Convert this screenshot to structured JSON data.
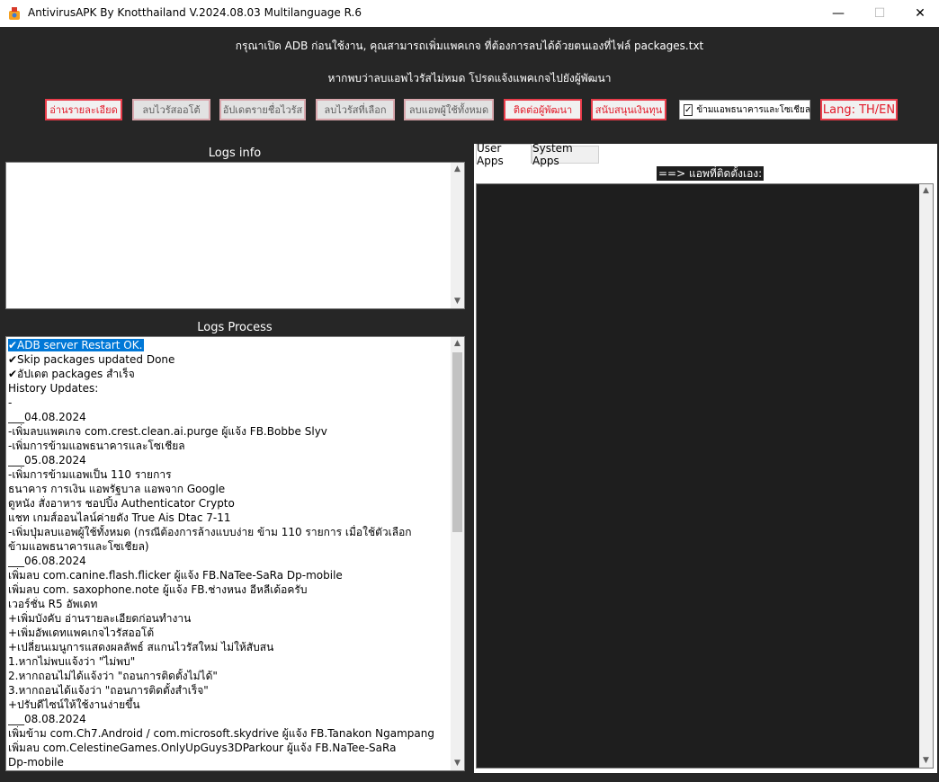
{
  "window": {
    "title": "AntivirusAPK By Knotthailand V.2024.08.03 Multilanguage R.6",
    "minimize": "—",
    "maximize": "☐",
    "close": "✕"
  },
  "notices": {
    "line1": "กรุณาเปิด ADB ก่อนใช้งาน, คุณสามารถเพิ่มแพคเกจ ที่ต้องการลบได้ด้วยตนเองที่ไฟล์ packages.txt",
    "line2": "หากพบว่าลบแอพไวรัสไม่หมด โปรดแจ้งแพคเกจไปยังผู้พัฒนา"
  },
  "toolbar": {
    "read_details": "อ่านรายละเอียด",
    "auto_remove": "ลบไวรัสออโต้",
    "update_virus_list": "อัปเดตรายชื่อไวรัส",
    "remove_selected": "ลบไวรัสที่เลือก",
    "remove_all_user_apps": "ลบแอพผู้ใช้ทั้งหมด",
    "contact_dev": "ติดต่อผู้พัฒนา",
    "donate": "สนับสนุนเงินทุน",
    "skip_bank_social": "ข้ามแอพธนาคารและโซเชียล",
    "skip_checked": "✓",
    "lang": "Lang: TH/EN"
  },
  "logs_info": {
    "label": "Logs info"
  },
  "logs_process": {
    "label": "Logs Process",
    "lines": [
      "✔ADB server Restart OK.",
      " ✔Skip packages updated Done",
      "✔อัปเดต packages สำเร็จ",
      "History Updates:",
      "-",
      "___04.08.2024",
      "-เพิ่มลบแพคเกจ com.crest.clean.ai.purge ผู้แจ้ง FB.Bobbe Slyv",
      "-เพิ่มการข้ามแอพธนาคารและโซเชียล",
      "___05.08.2024",
      "-เพิ่มการข้ามแอพเป็น 110 รายการ",
      " ธนาคาร การเงิน แอพรัฐบาล แอพจาก Google",
      " ดูหนัง สั่งอาหาร ชอปปิ้ง Authenticator Crypto",
      " แชท เกมส์ออนไลน์ค่ายดัง True Ais Dtac 7-11",
      "-เพิ่มปุ่มลบแอพผู้ใช้ทั้งหมด (กรณีต้องการล้างแบบง่าย ข้าม 110 รายการ เมื่อใช้ตัวเลือก",
      "ข้ามแอพธนาคารและโซเชียล)",
      "___06.08.2024",
      "เพิ่มลบ com.canine.flash.flicker ผู้แจ้ง FB.NaTee-SaRa Dp-mobile",
      "เพิ่มลบ com. saxophone.note ผู้แจ้ง FB.ช่างหนง อีหลีเด้อครับ",
      "เวอร์ชั่น R5 อัพเดท",
      "+เพิ่มบังคับ อ่านรายละเอียดก่อนทำงาน",
      "+เพิ่มอัพเดทแพคเกจไวรัสออโต้",
      "+เปลี่ยนเมนูการแสดงผลลัพธ์ สแกนไวรัสใหม่ ไม่ให้สับสน",
      "1.หากไม่พบแจ้งว่า \"ไม่พบ\"",
      "2.หากถอนไม่ได้แจ้งว่า \"ถอนการติดตั้งไม่ได้\"",
      "3.หากถอนได้แจ้งว่า \"ถอนการติดตั้งสำเร็จ\"",
      "+ปรับดีไซน์ให้ใช้งานง่ายขึ้น",
      "___08.08.2024",
      "เพิ่มข้าม  com.Ch7.Android / com.microsoft.skydrive ผู้แจ้ง FB.Tanakon Ngampang",
      "เพิ่มลบ com.CelestineGames.OnlyUpGuys3DParkour ผู้แจ้ง FB.NaTee-SaRa",
      "Dp-mobile"
    ]
  },
  "tabs": {
    "user_apps": "User Apps",
    "system_apps": "System Apps"
  },
  "apps_panel": {
    "header": "==> แอพที่ติดตั้งเอง:"
  },
  "scroll": {
    "up": "▲",
    "down": "▼"
  },
  "colors": {
    "background": "#262626",
    "accent_red": "#e21b2a",
    "selection": "#0078d7"
  }
}
